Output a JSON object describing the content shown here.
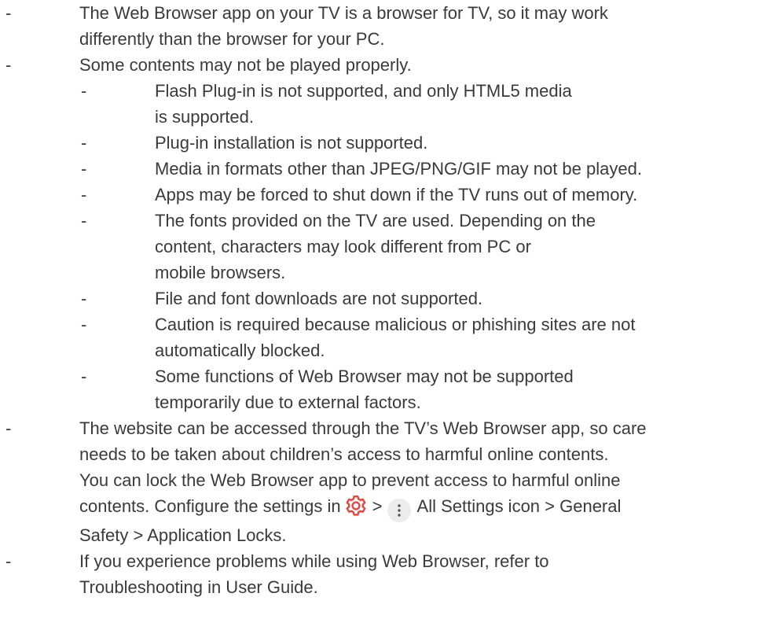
{
  "bullet": "-",
  "notes": [
    {
      "lines": [
        "The Web Browser app on your TV is a browser for TV, so it may work",
        "differently than the browser for your PC."
      ]
    },
    {
      "lines": [
        "Some contents may not be played properly."
      ],
      "subitems": [
        {
          "lines": [
            "Flash Plug-in is not supported, and only HTML5 media",
            "is supported."
          ]
        },
        {
          "lines": [
            "Plug-in installation is not supported."
          ]
        },
        {
          "lines": [
            "Media in formats other than JPEG/PNG/GIF may not be played."
          ]
        },
        {
          "lines": [
            "Apps may be forced to shut down if the TV runs out of memory."
          ]
        },
        {
          "lines": [
            "The fonts provided on the TV are used. Depending on the",
            "content, characters may look different from PC or",
            "mobile browsers."
          ]
        },
        {
          "lines": [
            "File and font downloads are not supported."
          ]
        },
        {
          "lines": [
            "Caution is required because malicious or phishing sites are not",
            "automatically blocked."
          ]
        },
        {
          "lines": [
            "Some functions of Web Browser may not be supported",
            "temporarily due to external factors."
          ]
        }
      ]
    },
    {
      "lines": [
        "The website can be accessed through the TV’s Web Browser app, so care",
        "needs to be taken about children’s access to harmful online contents.",
        "You can lock the Web Browser app to prevent access to harmful online"
      ],
      "settings_line": {
        "before": "contents. Configure the settings in",
        "separator": ">",
        "after": "All Settings icon > General"
      },
      "tail": "Safety > Application Locks."
    },
    {
      "lines": [
        "If you experience problems while using Web Browser, refer to",
        "Troubleshooting in User Guide."
      ]
    }
  ],
  "icons": {
    "settings": "gear-icon",
    "more": "more-options-icon"
  },
  "colors": {
    "text": "#3a3a3a",
    "gear_icon": "#e8463c",
    "more_icon_bg": "#ececec"
  }
}
